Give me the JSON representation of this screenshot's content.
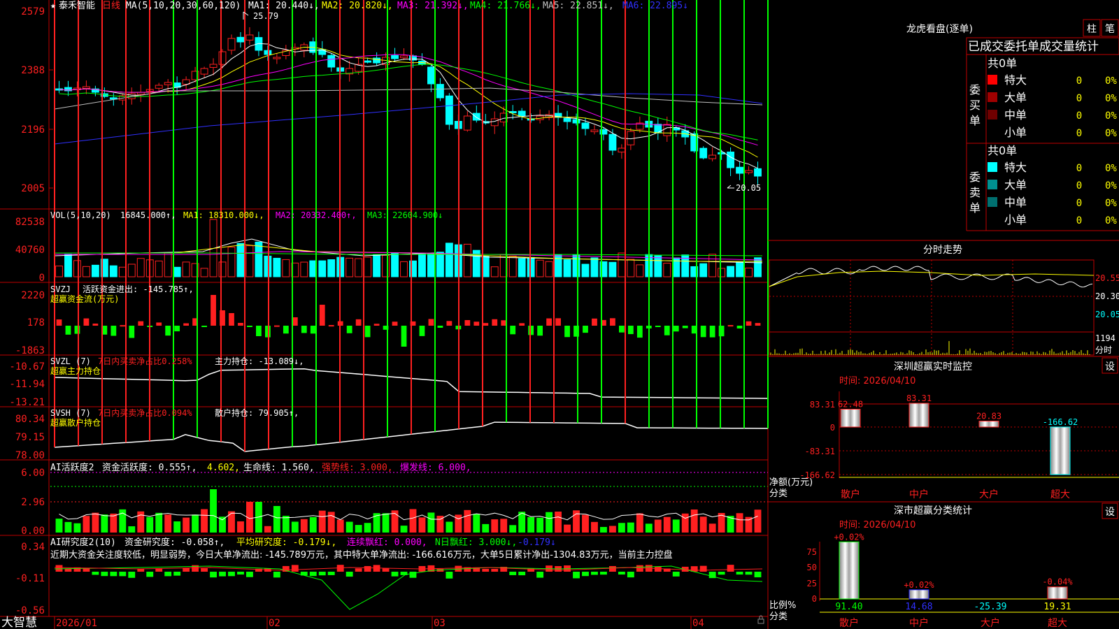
{
  "colors": {
    "up": "#ff2020",
    "down": "#00ffff",
    "frame": "#c00000",
    "ma1": "#ffffff",
    "ma2": "#ffff00",
    "ma3": "#ff00ff",
    "ma4": "#00ff00",
    "ma5": "#c0c0c0",
    "ma6": "#3030ff",
    "green": "#00ff00",
    "yellow": "#ffff00",
    "magenta": "#ff00ff"
  },
  "header": {
    "star": "★",
    "stock_name": "泰禾智能",
    "period": "日线",
    "ma_params": "MA(5,10,20,30,60,120)",
    "ma1": "MA1: 20.440↓,",
    "ma2": "MA2: 20.820↓,",
    "ma3": "MA3: 21.392↓,",
    "ma4": "MA4: 21.766↓,",
    "ma5": "MA5: 22.851↓,",
    "ma6": "MA6: 22.895↓"
  },
  "price_axis": [
    "2579",
    "2388",
    "2196",
    "2005"
  ],
  "price_annotations": {
    "high": "25.79",
    "low": "20.05"
  },
  "vol": {
    "label": "VOL(5,10,20)",
    "value": "16845.000↑,",
    "ma1": "MA1: 18310.000↓,",
    "ma2": "MA2: 20332.400↑,",
    "ma3": "MA3: 22604.900↓",
    "axis": [
      "82538",
      "40760",
      "0"
    ]
  },
  "svzj": {
    "label": "SVZJ",
    "text1": "活跃资金进出: -145.785↑,",
    "text2": "超赢资金流(万元)",
    "axis": [
      "2220",
      "178",
      "-1863"
    ]
  },
  "svzl": {
    "label": "SVZL (7)",
    "text1": "7日内买卖净占比0.258%",
    "text2": "主力持仓: -13.089↓,",
    "text3": "超赢主力持仓",
    "axis": [
      "-10.67",
      "-11.94",
      "-13.21"
    ]
  },
  "svsh": {
    "label": "SVSH (7)",
    "text1": "7日内买卖净占比0.094%",
    "text2": "散户持仓: 79.905↑,",
    "text3": "超赢散户持仓",
    "axis": [
      "80.34",
      "79.15",
      "78.00"
    ]
  },
  "ai1": {
    "label": "AI活跃度2",
    "t1": "资金活跃度: 0.555↑,",
    "t2": "4.602,",
    "t3": "生命线: 1.560,",
    "t4": "强势线: 3.000,",
    "t5": "爆发线: 6.000,",
    "axis": [
      "6.00",
      "2.96",
      "0.00"
    ]
  },
  "ai2": {
    "label": "AI研究度2(10)",
    "t1": "资金研究度: -0.058↑,",
    "t2": "平均研究度: -0.179↓,",
    "t3": "连续飘红: 0.000,",
    "t4": "N日飘红: 3.000↓,",
    "t5": "-0.179↓",
    "axis": [
      "0.34",
      "-0.11",
      "-0.56"
    ],
    "comment": "近期大资金关注度较低，明显弱势，今日大单净流出: -145.789万元，其中特大单净流出: -166.616万元，大单5日累计净出-1304.83万元，当前主力控盘"
  },
  "date_axis": [
    "2026/01",
    "02",
    "03",
    "04"
  ],
  "brand": "大智慧",
  "right": {
    "dragon_title": "龙虎看盘(逐单)",
    "btn_bar": "柱",
    "btn_pen": "笔",
    "tabs": [
      "已成交",
      "委托单",
      "成交量统计"
    ],
    "buy": {
      "vlabel": "委买单",
      "count": "共0单",
      "rows": [
        {
          "name": "特大",
          "v": "0",
          "p": "0%",
          "c": "#ff0000"
        },
        {
          "name": "大单",
          "v": "0",
          "p": "0%",
          "c": "#a00000"
        },
        {
          "name": "中单",
          "v": "0",
          "p": "0%",
          "c": "#700000"
        },
        {
          "name": "小单",
          "v": "0",
          "p": "0%",
          "c": ""
        }
      ]
    },
    "sell": {
      "vlabel": "委卖单",
      "count": "共0单",
      "rows": [
        {
          "name": "特大",
          "v": "0",
          "p": "0%",
          "c": "#00ffff"
        },
        {
          "name": "大单",
          "v": "0",
          "p": "0%",
          "c": "#009090"
        },
        {
          "name": "中单",
          "v": "0",
          "p": "0%",
          "c": "#007070"
        },
        {
          "name": "小单",
          "v": "0",
          "p": "0%",
          "c": ""
        }
      ]
    },
    "intraday": {
      "title": "分时走势",
      "axis": [
        "20.55",
        "20.30",
        "20.05"
      ],
      "vol_axis": [
        "1194",
        "分时"
      ]
    },
    "sz_monitor": {
      "title": "深圳超赢实时监控",
      "btn": "设",
      "time": "时间: 2026/04/10",
      "axis": [
        "83.31",
        "0",
        "-83.31",
        "-166.62"
      ],
      "ylabel": "净额(万元)",
      "xlabel": "分类",
      "bars": [
        {
          "cat": "散户",
          "v": 62.48,
          "label": "62.48"
        },
        {
          "cat": "中户",
          "v": 83.31,
          "label": "83.31"
        },
        {
          "cat": "大户",
          "v": 20.83,
          "label": "20.83"
        },
        {
          "cat": "超大",
          "v": -166.62,
          "label": "-166.62"
        }
      ]
    },
    "sz_class": {
      "title": "深市超赢分类统计",
      "btn": "设",
      "time": "时间: 2026/04/10",
      "axis": [
        "75",
        "50",
        "25",
        "0"
      ],
      "ylabel": "比例%",
      "xlabel": "分类",
      "bars": [
        {
          "cat": "散户",
          "v": 91.4,
          "top": "+0.02%",
          "bottom": "91.40",
          "c": "#00ff00",
          "bc": "#00ff00"
        },
        {
          "cat": "中户",
          "v": 14.68,
          "top": "+0.02%",
          "bottom": "14.68",
          "c": "#2020ff",
          "bc": "#3030ff"
        },
        {
          "cat": "大户",
          "v": 0,
          "top": "",
          "bottom": "-25.39",
          "c": "#00ffff",
          "bc": "#00ffff"
        },
        {
          "cat": "超大",
          "v": 19.31,
          "top": "-0.04%",
          "bottom": "19.31",
          "c": "#ff2020",
          "bc": "#ffff00"
        }
      ]
    }
  }
}
